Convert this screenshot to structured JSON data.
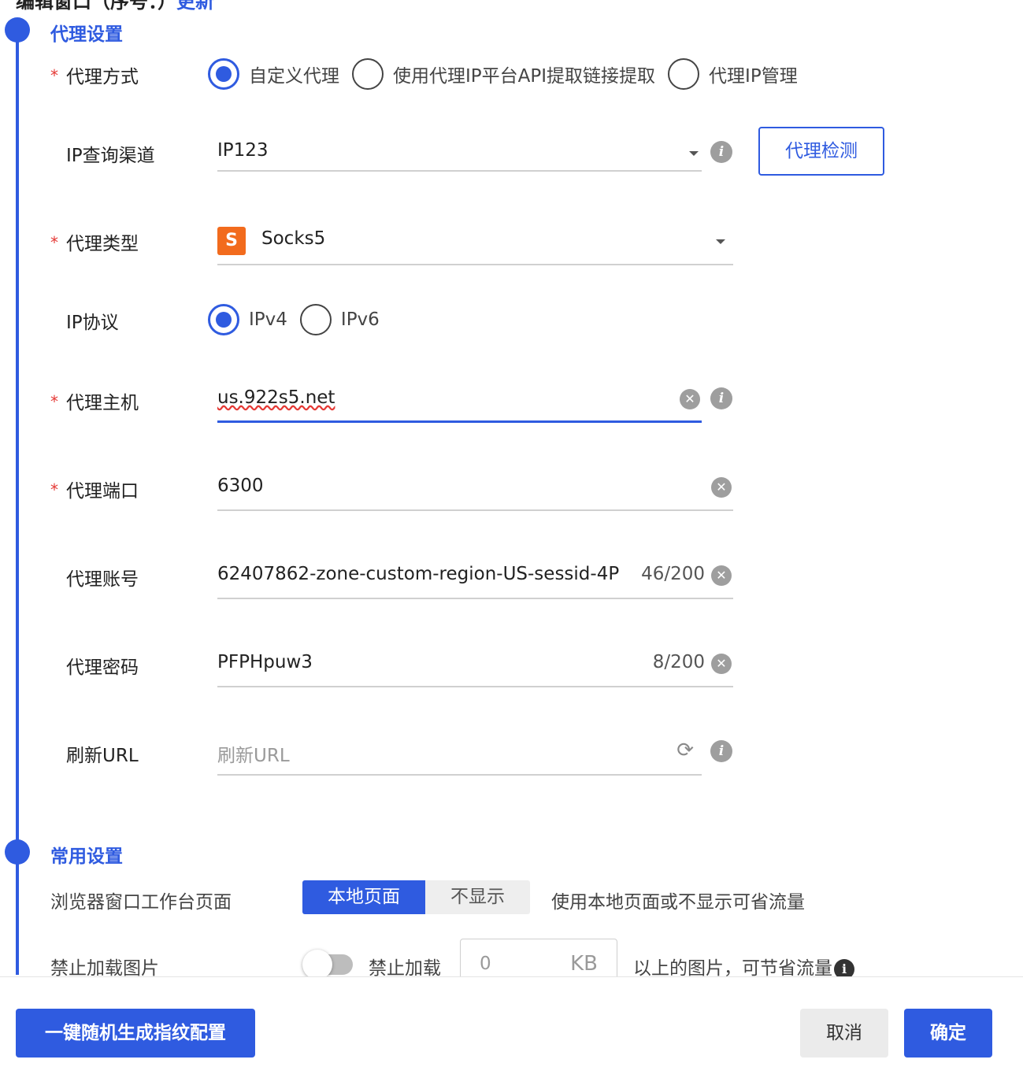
{
  "header": {
    "title": "编辑窗口（序号：）",
    "title_link": "更新"
  },
  "colors": {
    "accent": "#2f5be0",
    "required": "#e53935",
    "socks_badge": "#f26b1d"
  },
  "proxy_section": {
    "title": "代理设置",
    "required_mark": "*",
    "proxy_mode": {
      "label": "代理方式",
      "options": [
        "自定义代理",
        "使用代理IP平台API提取链接提取",
        "代理IP管理"
      ],
      "selected": "自定义代理"
    },
    "ip_channel": {
      "label": "IP查询渠道",
      "value": "IP123",
      "check_button": "代理检测"
    },
    "proxy_type": {
      "label": "代理类型",
      "icon_letter": "S",
      "value": "Socks5"
    },
    "ip_protocol": {
      "label": "IP协议",
      "options": [
        "IPv4",
        "IPv6"
      ],
      "selected": "IPv4"
    },
    "host": {
      "label": "代理主机",
      "value": "us.922s5.net"
    },
    "port": {
      "label": "代理端口",
      "value": "6300"
    },
    "account": {
      "label": "代理账号",
      "value": "62407862-zone-custom-region-US-sessid-4P",
      "counter": "46/200"
    },
    "password": {
      "label": "代理密码",
      "value": "PFPHpuw3",
      "counter": "8/200"
    },
    "refresh_url": {
      "label": "刷新URL",
      "placeholder": "刷新URL"
    }
  },
  "common_section": {
    "title": "常用设置",
    "workbench": {
      "label": "浏览器窗口工作台页面",
      "options": [
        "本地页面",
        "不显示"
      ],
      "selected": "本地页面",
      "hint": "使用本地页面或不显示可省流量"
    },
    "block_images": {
      "label": "禁止加载图片",
      "toggle_on": false,
      "prefix": "禁止加载",
      "size_value": "0",
      "unit": "KB",
      "hint": "以上的图片，可节省流量"
    }
  },
  "footer": {
    "random_button": "一键随机生成指纹配置",
    "cancel_button": "取消",
    "confirm_button": "确定"
  },
  "icons": {
    "info": "i",
    "clear": "✕",
    "refresh": "⟳"
  }
}
